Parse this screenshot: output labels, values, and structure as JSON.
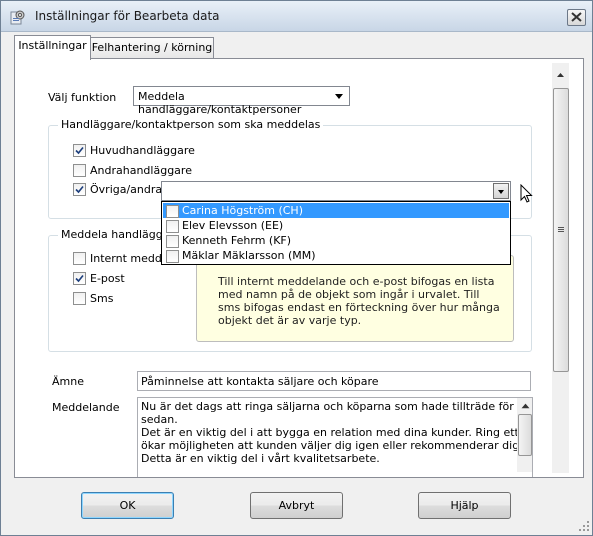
{
  "window": {
    "title": "Inställningar för Bearbeta data"
  },
  "tabs": [
    {
      "label": "Inställningar",
      "active": true
    },
    {
      "label": "Felhantering / körning",
      "active": false
    }
  ],
  "function": {
    "label": "Välj funktion",
    "value": "Meddela handläggare/kontaktpersoner"
  },
  "recipients_group": {
    "title": "Handläggare/kontaktperson som ska meddelas",
    "options": [
      {
        "label": "Huvudhandläggare",
        "checked": true
      },
      {
        "label": "Andrahandläggare",
        "checked": false
      },
      {
        "label": "Övriga/andra:",
        "checked": true
      }
    ],
    "dropdown_items": [
      {
        "label": "Carina Högström (CH)",
        "checked": false,
        "highlighted": true
      },
      {
        "label": "Elev Elevsson (EE)",
        "checked": false,
        "highlighted": false
      },
      {
        "label": "Kenneth Fehrm (KF)",
        "checked": false,
        "highlighted": false
      },
      {
        "label": "Mäklar Mäklarsson (MM)",
        "checked": false,
        "highlighted": false
      }
    ]
  },
  "notify_group": {
    "title": "Meddela handläggare",
    "options": [
      {
        "label": "Internt meddelande",
        "checked": false
      },
      {
        "label": "E-post",
        "checked": true
      },
      {
        "label": "Sms",
        "checked": false
      }
    ],
    "tooltip": "Till internt meddelande och e-post bifogas en lista med namn på de objekt som ingår i urvalet. Till sms bifogas endast en förteckning över hur många objekt det är av varje typ."
  },
  "subject": {
    "label": "Ämne",
    "value": "Påminnelse att kontakta säljare och köpare"
  },
  "message": {
    "label": "Meddelande",
    "lines": [
      "Nu är det dags att ringa säljarna och köparna som hade tillträde för två veckor",
      "sedan.",
      "Det är en viktig del i att bygga en relation med dina kunder. Ring ett samtal så",
      "ökar möjligheten att kunden väljer dig igen eller rekommenderar dig vidare.",
      "Detta är en viktig del i vårt kvalitetsarbete."
    ]
  },
  "buttons": {
    "ok": "OK",
    "cancel": "Avbryt",
    "help": "Hjälp"
  },
  "colors": {
    "highlight": "#3399ff",
    "tooltip_bg": "#ffffe1"
  }
}
